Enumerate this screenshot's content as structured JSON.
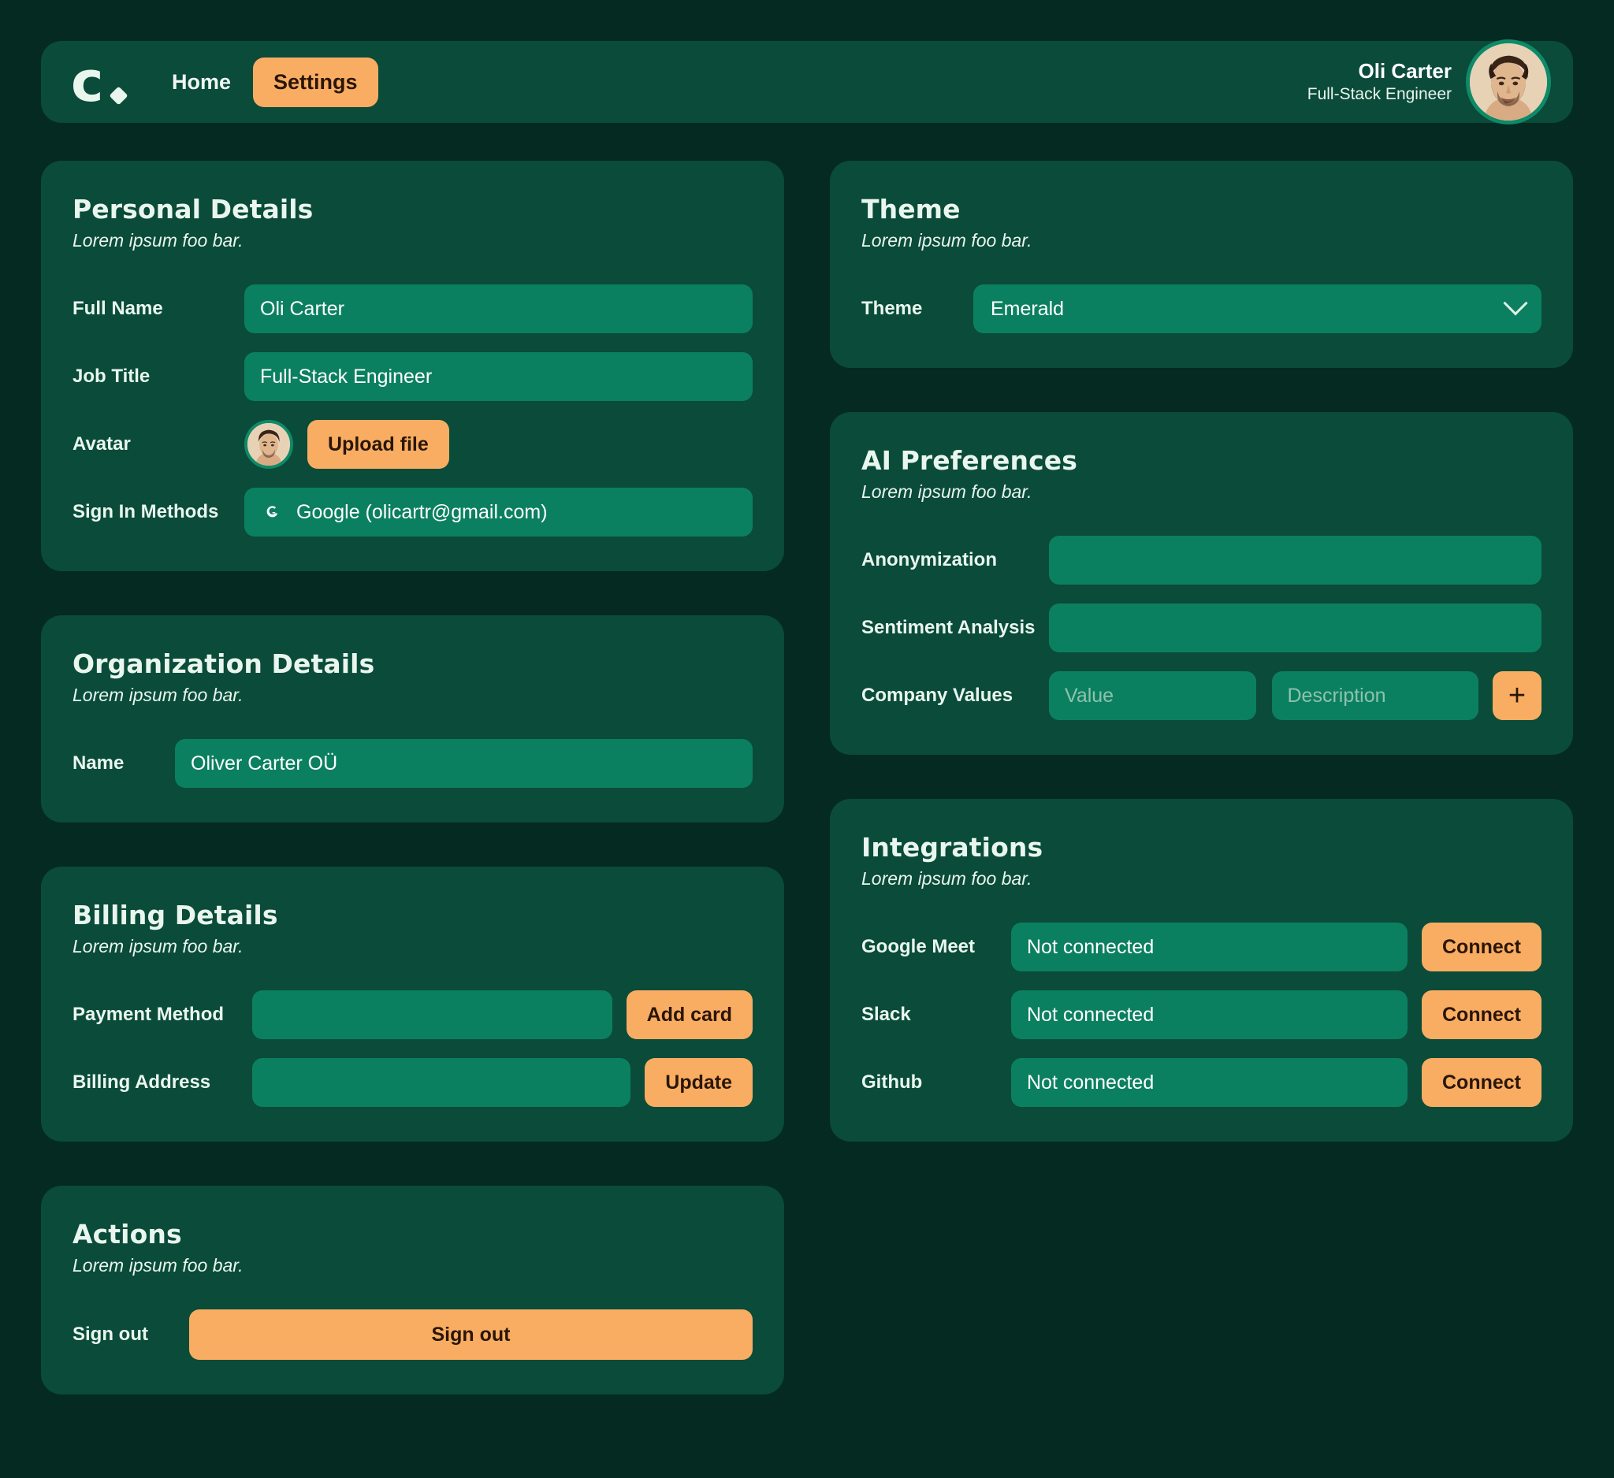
{
  "brand": {
    "logo_letter": "c",
    "logo_name": "c-logo"
  },
  "header": {
    "nav": [
      {
        "label": "Home",
        "active": false
      },
      {
        "label": "Settings",
        "active": true
      }
    ],
    "user": {
      "name": "Oli Carter",
      "role": "Full-Stack Engineer"
    }
  },
  "personal_details": {
    "title": "Personal Details",
    "subtitle": "Lorem ipsum foo bar.",
    "full_name_label": "Full Name",
    "full_name_value": "Oli Carter",
    "job_title_label": "Job Title",
    "job_title_value": "Full-Stack Engineer",
    "avatar_label": "Avatar",
    "upload_label": "Upload file",
    "sign_in_label": "Sign In Methods",
    "sign_in_value": "Google (olicartr@gmail.com)",
    "sign_in_icon": "google-icon"
  },
  "organization_details": {
    "title": "Organization Details",
    "subtitle": "Lorem ipsum foo bar.",
    "name_label": "Name",
    "name_value": "Oliver Carter OÜ"
  },
  "billing_details": {
    "title": "Billing Details",
    "subtitle": "Lorem ipsum foo bar.",
    "payment_method_label": "Payment Method",
    "payment_method_value": "",
    "add_card_label": "Add card",
    "billing_address_label": "Billing Address",
    "billing_address_value": "",
    "update_label": "Update"
  },
  "actions": {
    "title": "Actions",
    "subtitle": "Lorem ipsum foo bar.",
    "sign_out_label": "Sign out",
    "sign_out_button": "Sign out"
  },
  "theme": {
    "title": "Theme",
    "subtitle": "Lorem ipsum foo bar.",
    "theme_label": "Theme",
    "theme_value": "Emerald"
  },
  "ai_preferences": {
    "title": "AI Preferences",
    "subtitle": "Lorem ipsum foo bar.",
    "anonymization_label": "Anonymization",
    "anonymization_value": "",
    "sentiment_label": "Sentiment Analysis",
    "sentiment_value": "",
    "company_values_label": "Company Values",
    "value_placeholder": "Value",
    "description_placeholder": "Description",
    "add_label": "+"
  },
  "integrations": {
    "title": "Integrations",
    "subtitle": "Lorem ipsum foo bar.",
    "items": [
      {
        "name": "Google Meet",
        "status": "Not connected",
        "action": "Connect"
      },
      {
        "name": "Slack",
        "status": "Not connected",
        "action": "Connect"
      },
      {
        "name": "Github",
        "status": "Not connected",
        "action": "Connect"
      }
    ]
  },
  "colors": {
    "page_bg": "#042a21",
    "card_bg": "#0a4b39",
    "field_bg": "#0b8060",
    "accent": "#f9ad62",
    "text": "#e9f6ee",
    "avatar_ring": "#0f8a68"
  }
}
